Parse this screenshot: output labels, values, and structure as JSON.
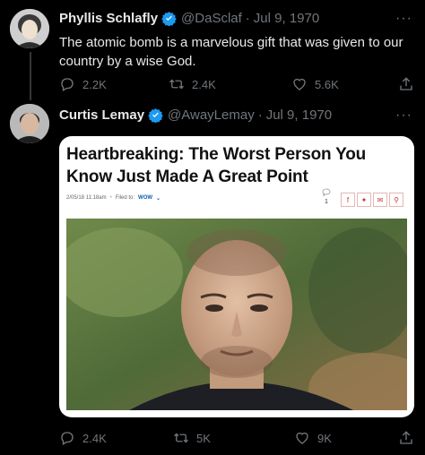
{
  "tweets": [
    {
      "name": "Phyllis Schlafly",
      "handle": "@DaSclaf",
      "dot": "·",
      "date": "Jul 9, 1970",
      "text": "The atomic bomb is a marvelous gift that was given to our country by a wise God.",
      "replies": "2.2K",
      "retweets": "2.4K",
      "likes": "5.6K",
      "more": "···"
    },
    {
      "name": "Curtis Lemay",
      "handle": "@AwayLemay",
      "dot": "·",
      "date": "Jul 9, 1970",
      "replies": "2.4K",
      "retweets": "5K",
      "likes": "9K",
      "more": "···",
      "card": {
        "headline": "Heartbreaking: The Worst Person You Know Just Made A Great Point",
        "meta_time": "2/05/18 11:18am",
        "meta_filed": "Filed to:",
        "meta_category": "WOW",
        "comment_count": "1",
        "share_icons": [
          "facebook-icon",
          "twitter-icon",
          "email-icon",
          "link-icon"
        ]
      }
    }
  ],
  "colors": {
    "background": "#000000",
    "text": "#e7e9ea",
    "muted": "#71767b",
    "verified": "#1d9bf0"
  }
}
